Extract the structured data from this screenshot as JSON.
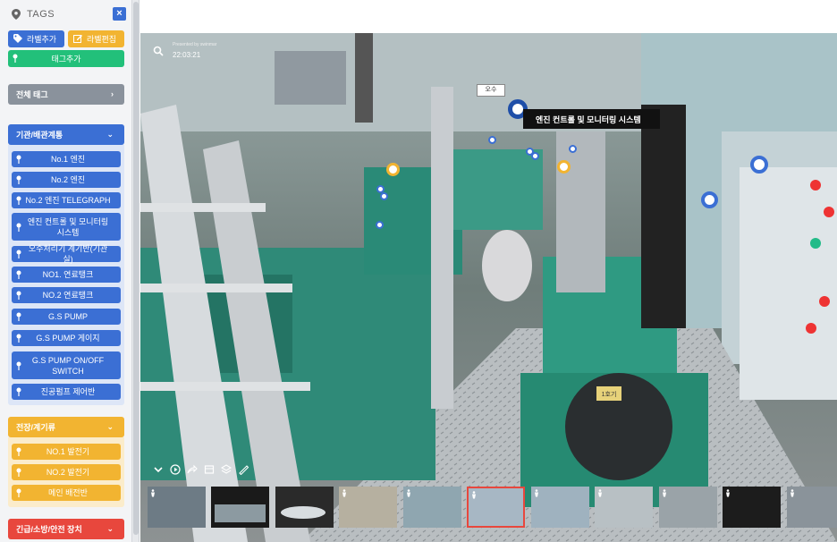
{
  "sidebar": {
    "title": "TAGS",
    "close_label": "×",
    "add_label_button": "라벨추가",
    "edit_label_button": "라벨편집",
    "add_tag_button": "태그추가",
    "sections": {
      "all": {
        "label": "전체 태그"
      },
      "engine": {
        "label": "기관/배관계통",
        "items": [
          "No.1 엔진",
          "No.2 엔진",
          "No.2 엔진 TELEGRAPH",
          "엔진 컨트롤 및 모니터링 시스템",
          "오수처리기 계기반(기관실)",
          "NO1. 연료탱크",
          "NO.2 연료탱크",
          "G.S PUMP",
          "G.S PUMP 게이지",
          "G.S PUMP ON/OFF SWITCH",
          "진공펌프 제어반"
        ]
      },
      "electric": {
        "label": "전장/계기류",
        "items": [
          "NO.1 발전기",
          "NO.2 발전기",
          "메인 배전반"
        ]
      },
      "safety": {
        "label": "긴급/소방/안전 장치"
      }
    }
  },
  "viewer": {
    "brand": "Presented by swinmar",
    "time": "22:03:21",
    "sign_text": "오수",
    "tooltip": "엔진 컨트롤 및 모니터링 시스템",
    "plate_text": "1호기"
  },
  "colors": {
    "blue": "#3b6fd4",
    "yellow": "#f2b431",
    "green": "#22c07a",
    "red": "#e8473d",
    "gray": "#8a929c"
  }
}
